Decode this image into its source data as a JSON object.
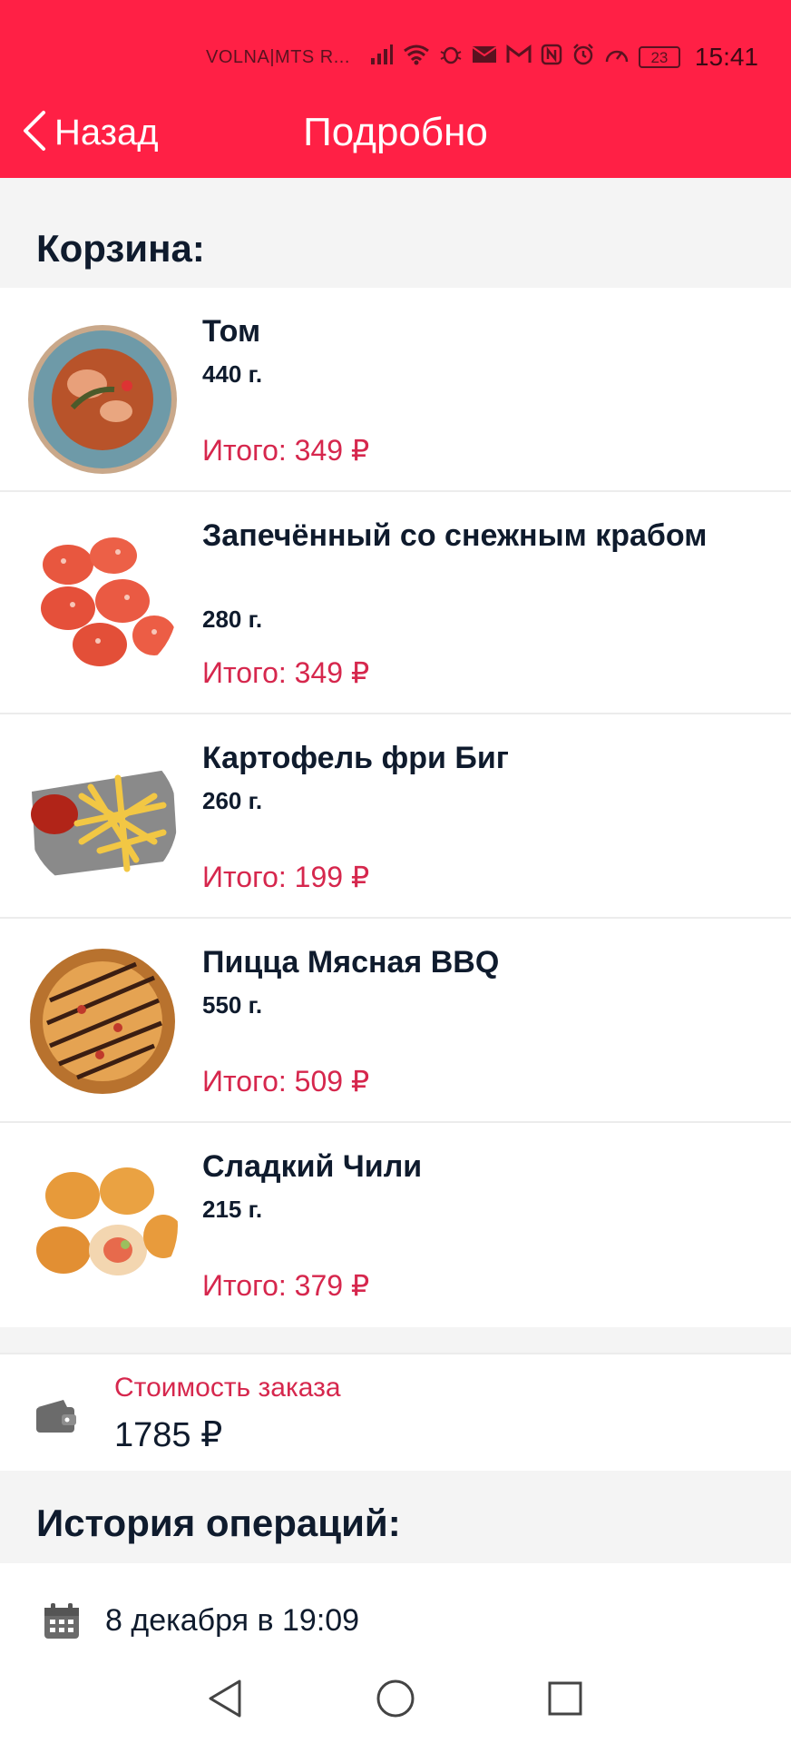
{
  "status_bar": {
    "carrier": "VOLNA|MTS R...",
    "battery": "23",
    "time": "15:41",
    "icons": [
      "signal-icon",
      "wifi-icon",
      "bug-icon",
      "mail-icon",
      "gmail-icon",
      "nfc-icon",
      "alarm-icon",
      "speedometer-icon",
      "battery-icon"
    ]
  },
  "header": {
    "back_label": "Назад",
    "title": "Подробно",
    "color": "#ff2045"
  },
  "cart": {
    "heading": "Корзина:",
    "items": [
      {
        "name": "Том",
        "weight": "440 г.",
        "total": "Итого: 349 ₽",
        "image": "soup-bowl"
      },
      {
        "name": "Запечённый со снежным крабом",
        "weight": "280 г.",
        "total": "Итого: 349 ₽",
        "image": "baked-rolls"
      },
      {
        "name": "Картофель фри Биг",
        "weight": "260 г.",
        "total": "Итого: 199 ₽",
        "image": "french-fries"
      },
      {
        "name": "Пицца Мясная BBQ",
        "weight": "550 г.",
        "total": "Итого: 509 ₽",
        "image": "bbq-pizza"
      },
      {
        "name": "Сладкий Чили",
        "weight": "215 г.",
        "total": "Итого: 379 ₽",
        "image": "sushi-rolls"
      }
    ]
  },
  "summary": {
    "label": "Стоимость заказа",
    "value": "1785 ₽",
    "icon": "wallet-icon"
  },
  "history": {
    "heading": "История операций:",
    "operations": [
      {
        "date": "8 декабря в 19:09",
        "icon": "calendar-icon"
      }
    ]
  },
  "colors": {
    "accent": "#ff2045",
    "price": "#d6274d",
    "text": "#0f1b2d"
  }
}
